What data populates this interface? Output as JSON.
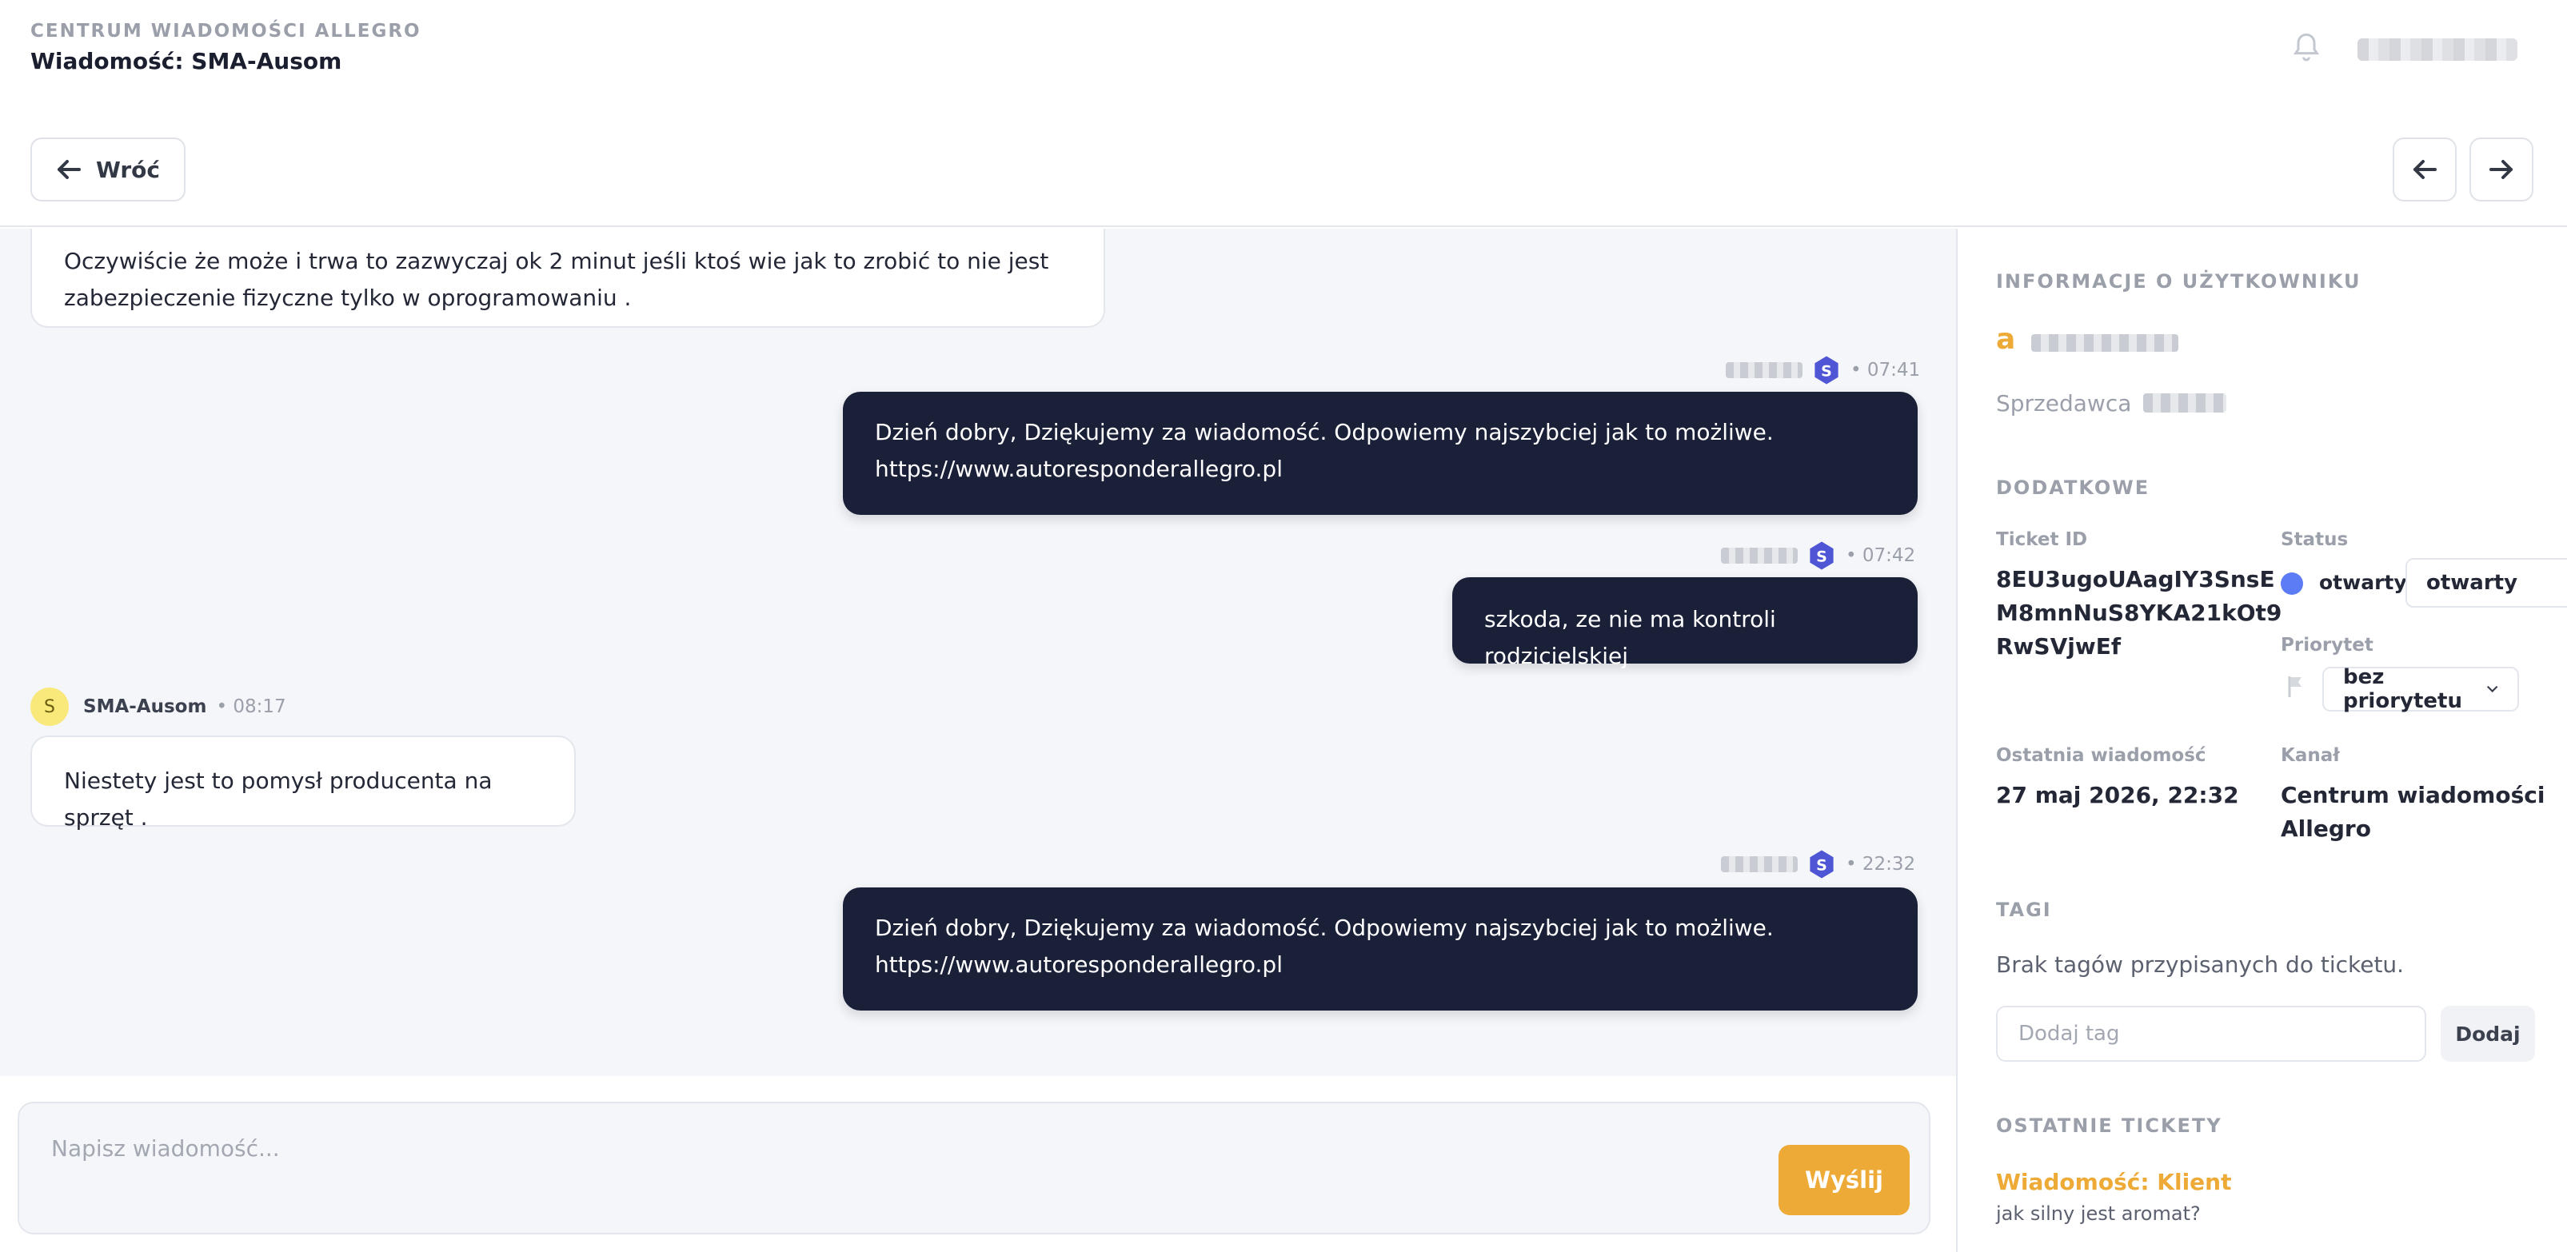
{
  "header": {
    "breadcrumb": "CENTRUM WIADOMOŚCI ALLEGRO",
    "title": "Wiadomość: SMA-Ausom",
    "back_label": "Wróć"
  },
  "messages": [
    {
      "direction": "in",
      "text_line1": "Oczywiście że może i trwa to zazwyczaj ok 2 minut jeśli ktoś wie jak to zrobić to nie jest",
      "text_line2": "zabezpieczenie fizyczne tylko w oprogramowaniu ."
    },
    {
      "direction": "out",
      "time": "• 07:41",
      "text_line1": "Dzień dobry, Dziękujemy za wiadomość. Odpowiemy najszybciej jak to możliwe.",
      "text_line2": "https://www.autoresponderallegro.pl"
    },
    {
      "direction": "out",
      "time": "• 07:42",
      "text_line1": "szkoda, ze nie ma kontroli rodzicielskiej"
    },
    {
      "direction": "in",
      "sender": "SMA-Ausom",
      "avatar_letter": "S",
      "time": "• 08:17",
      "text_line1": "Niestety jest to pomysł producenta na sprzęt ."
    },
    {
      "direction": "out",
      "time": "• 22:32",
      "text_line1": "Dzień dobry, Dziękujemy za wiadomość. Odpowiemy najszybciej jak to możliwe.",
      "text_line2": "https://www.autoresponderallegro.pl"
    }
  ],
  "composer": {
    "placeholder": "Napisz wiadomość...",
    "send_label": "Wyślij"
  },
  "sidebar": {
    "user_section_title": "INFORMACJE O UŻYTKOWNIKU",
    "user_prefix": "a",
    "seller_label": "Sprzedawca",
    "extra_section_title": "DODATKOWE",
    "ticket_id_label": "Ticket ID",
    "ticket_id_line1": "8EU3ugoUAagIY3SnsE",
    "ticket_id_line2": "M8mnNuS8YKA21kOt9",
    "ticket_id_line3": "RwSVjwEf",
    "status_label": "Status",
    "status_value": "otwarty",
    "status_select_value": "otwarty",
    "priority_label": "Priorytet",
    "priority_value": "bez priorytetu",
    "last_message_label": "Ostatnia wiadomość",
    "last_message_value": "27 maj 2026, 22:32",
    "channel_label": "Kanał",
    "channel_line1": "Centrum wiadomości",
    "channel_line2": "Allegro",
    "tags_section_title": "TAGI",
    "no_tags_text": "Brak tagów przypisanych do ticketu.",
    "tag_placeholder": "Dodaj tag",
    "add_tag_label": "Dodaj",
    "recent_section_title": "OSTATNIE TICKETY",
    "recent_ticket_title": "Wiadomość: Klient",
    "recent_ticket_snippet": "jak silny jest aromat?"
  },
  "colors": {
    "accent": "#eeaa36",
    "dark_bubble": "#1b2039",
    "status_dot": "#5b7cf5",
    "badge": "#4f56d6"
  }
}
